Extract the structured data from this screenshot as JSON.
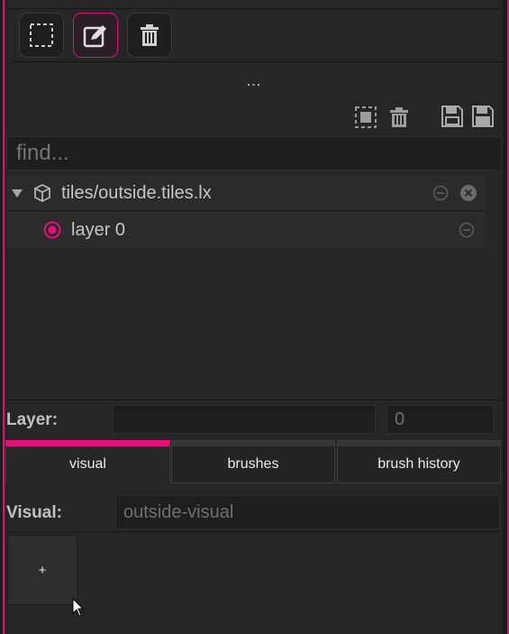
{
  "toolbar": {
    "buttons": [
      {
        "icon": "select-rect-icon",
        "active": false
      },
      {
        "icon": "edit-icon",
        "active": true
      },
      {
        "icon": "trash-icon",
        "active": false
      }
    ]
  },
  "more_label": "...",
  "layers_toolbar": {
    "icons": [
      "select-all-icon",
      "delete-icon",
      "save-icon",
      "save-all-icon"
    ]
  },
  "search": {
    "placeholder": "find...",
    "value": ""
  },
  "tree": {
    "tileset": {
      "label": "tiles/outside.tiles.lx",
      "expanded": true
    },
    "layers": [
      {
        "label": "layer 0",
        "selected": true
      }
    ]
  },
  "layer_props": {
    "label": "Layer:",
    "name_value": "",
    "index_value": "0"
  },
  "tabs": [
    {
      "label": "visual",
      "active": true
    },
    {
      "label": "brushes",
      "active": false
    },
    {
      "label": "brush history",
      "active": false
    }
  ],
  "visual": {
    "label": "Visual:",
    "value": "outside-visual"
  },
  "add_button": {
    "label": "+"
  },
  "colors": {
    "accent": "#e3107a",
    "background": "#262626"
  }
}
